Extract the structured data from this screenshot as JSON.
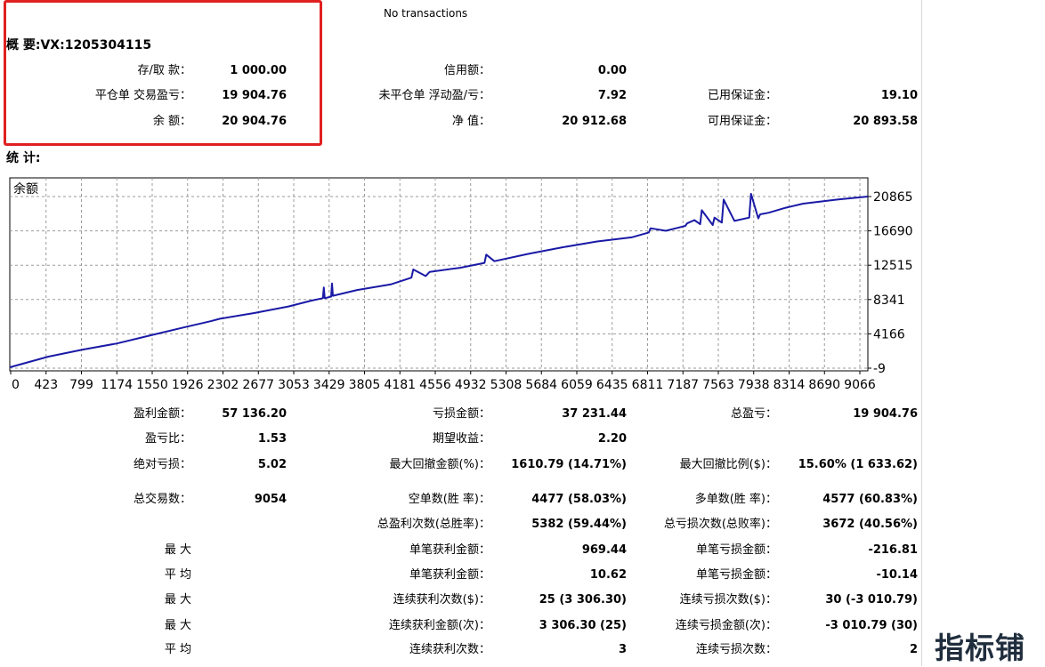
{
  "no_transactions": "No transactions",
  "summary": {
    "title": "概 要:VX:1205304115",
    "rows": [
      [
        "存/取 款：",
        "1 000.00",
        "信用额：",
        "0.00",
        "",
        ""
      ],
      [
        "平仓单 交易盈亏：",
        "19 904.76",
        "未平仓单 浮动盈/亏：",
        "7.92",
        "已用保证金：",
        "19.10"
      ],
      [
        "余 额：",
        "20 904.76",
        "净 值：",
        "20 912.68",
        "可用保证金：",
        "20 893.58"
      ]
    ]
  },
  "stats_title": "统 计:",
  "chart_data": {
    "type": "line",
    "title": "余额",
    "x_tick_labels": [
      "0",
      "423",
      "799",
      "1174",
      "1550",
      "1926",
      "2302",
      "2677",
      "3053",
      "3429",
      "3805",
      "4181",
      "4556",
      "4932",
      "5308",
      "5684",
      "6059",
      "6435",
      "6811",
      "7187",
      "7563",
      "7938",
      "8314",
      "8690",
      "9066"
    ],
    "y_tick_labels": [
      "20865",
      "16690",
      "12515",
      "8341",
      "4166",
      "-9"
    ],
    "xlim": [
      0,
      9400
    ],
    "ylim": [
      -9,
      20865
    ],
    "series": [
      {
        "x": [
          0,
          423,
          799,
          1174,
          1550,
          1926,
          2200,
          2302,
          2677,
          3053,
          3300,
          3429,
          3440,
          3450,
          3520,
          3530,
          3540,
          3805,
          4181,
          4400,
          4420,
          4556,
          4600,
          4932,
          5200,
          5220,
          5308,
          5684,
          6059,
          6435,
          6811,
          7000,
          7020,
          7187,
          7400,
          7420,
          7500,
          7563,
          7580,
          7700,
          7720,
          7800,
          7820,
          7938,
          8100,
          8120,
          8200,
          8220,
          8314,
          8500,
          8690,
          9066,
          9400
        ],
        "y": [
          100,
          1400,
          2250,
          3000,
          4000,
          5000,
          5700,
          6000,
          6700,
          7500,
          8200,
          8500,
          9800,
          8500,
          8700,
          10300,
          8800,
          9500,
          10200,
          11000,
          12000,
          11200,
          11700,
          12200,
          12800,
          13800,
          13000,
          13900,
          14700,
          15400,
          15900,
          16500,
          17000,
          16700,
          17300,
          17600,
          18000,
          17500,
          19200,
          17400,
          18300,
          17700,
          20500,
          17900,
          18300,
          21200,
          18200,
          18700,
          18900,
          19500,
          20000,
          20500,
          20865
        ],
        "color": "#1a1aa6"
      }
    ]
  },
  "stats": {
    "block1": [
      [
        "盈利金额：",
        "57 136.20",
        "亏损金额：",
        "37 231.44",
        "总盈亏：",
        "19 904.76"
      ],
      [
        "盈亏比：",
        "1.53",
        "期望收益：",
        "2.20",
        "",
        ""
      ],
      [
        "绝对亏损：",
        "5.02",
        "最大回撤金额(%)：",
        "1610.79 (14.71%)",
        "最大回撤比例($)：",
        "15.60% (1 633.62)"
      ]
    ],
    "block2": [
      [
        "总交易数：",
        "9054",
        "空单数(胜 率)：",
        "4477 (58.03%)",
        "多单数(胜 率)：",
        "4577 (60.83%)"
      ],
      [
        "",
        "",
        "总盈利次数(总胜率)：",
        "5382 (59.44%)",
        "总亏损次数(总败率)：",
        "3672 (40.56%)"
      ],
      [
        "最 大",
        "",
        "单笔获利金额：",
        "969.44",
        "单笔亏损金额：",
        "-216.81"
      ],
      [
        "平 均",
        "",
        "单笔获利金额：",
        "10.62",
        "单笔亏损金额：",
        "-10.14"
      ],
      [
        "最 大",
        "",
        "连续获利次数($)：",
        "25 (3 306.30)",
        "连续亏损次数($)：",
        "30 (-3 010.79)"
      ],
      [
        "最 大",
        "",
        "连续获利金额(次)：",
        "3 306.30 (25)",
        "连续亏损金额(次)：",
        "-3 010.79 (30)"
      ],
      [
        "平 均",
        "",
        "连续获利次数：",
        "3",
        "连续亏损次数：",
        "2"
      ]
    ]
  },
  "watermark": "指标铺"
}
